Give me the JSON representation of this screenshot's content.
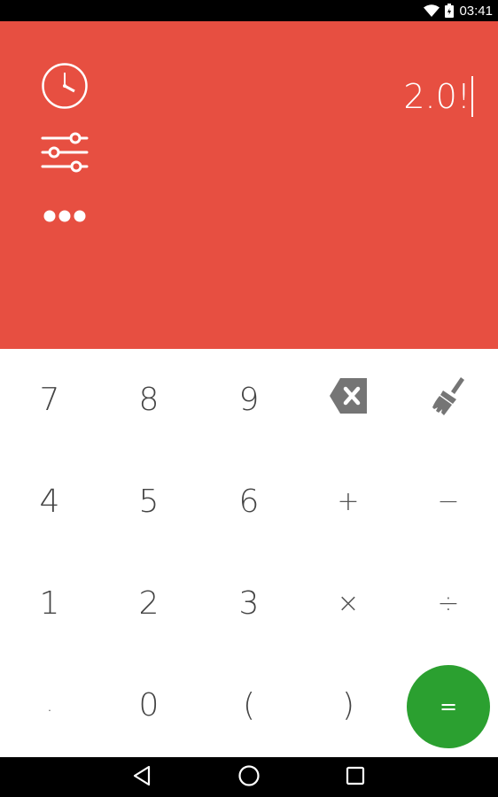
{
  "status_bar": {
    "time": "03:41",
    "icons": [
      "wifi-icon",
      "battery-icon"
    ]
  },
  "display": {
    "expression": "2.0!",
    "background_color": "#e74f41",
    "side_icons": [
      "history-icon",
      "settings-sliders-icon",
      "more-options-icon"
    ]
  },
  "keypad": {
    "rows": [
      [
        "7",
        "8",
        "9",
        "backspace",
        "clear"
      ],
      [
        "4",
        "5",
        "6",
        "+",
        "−"
      ],
      [
        "1",
        "2",
        "3",
        "×",
        "÷"
      ],
      [
        ".",
        "0",
        "(",
        ")",
        "="
      ]
    ],
    "keys": {
      "k7": "7",
      "k8": "8",
      "k9": "9",
      "k4": "4",
      "k5": "5",
      "k6": "6",
      "k1": "1",
      "k2": "2",
      "k3": "3",
      "dot": ".",
      "k0": "0",
      "lparen": "(",
      "rparen": ")",
      "plus": "+",
      "minus": "−",
      "times": "×",
      "divide": "÷",
      "equals": "="
    },
    "equals_color": "#2ba030",
    "icon_color": "#757575"
  },
  "nav_bar": {
    "icons": [
      "back-icon",
      "home-icon",
      "recents-icon"
    ]
  }
}
